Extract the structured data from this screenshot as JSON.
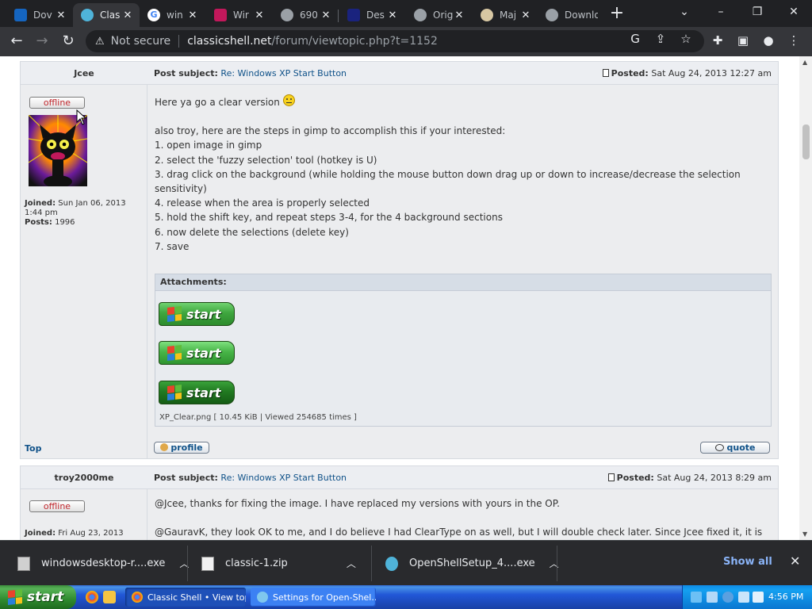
{
  "colors": {
    "chrome_bg": "#202124",
    "toolbar_bg": "#35363a",
    "link": "#105289",
    "offline": "#c0272d",
    "xp_start_green": "#2f8b2f",
    "xp_taskbar_blue": "#2157d7"
  },
  "tabs": [
    {
      "label": "Dov",
      "icon": "site-s-icon",
      "color": "#1565c0"
    },
    {
      "label": "Clas",
      "icon": "classic-shell-icon",
      "color": "#4fb3d9",
      "active": true
    },
    {
      "label": "win",
      "icon": "google-icon",
      "color": "#ffffff"
    },
    {
      "label": "Wir",
      "icon": "image-icon",
      "color": "#c2185b"
    },
    {
      "label": "690",
      "icon": "globe-icon",
      "color": "#9aa0a6"
    },
    {
      "label": "Des",
      "icon": "deviantart-icon",
      "color": "#1a237e"
    },
    {
      "label": "Orig",
      "icon": "globe-icon",
      "color": "#9aa0a6"
    },
    {
      "label": "Maj",
      "icon": "avatar-icon",
      "color": "#d7c7a3"
    },
    {
      "label": "Downlo",
      "icon": "globe-icon",
      "color": "#9aa0a6"
    }
  ],
  "omnibox": {
    "security": "Not secure",
    "host": "classicshell.net",
    "path": "/forum/viewtopic.php?t=1152"
  },
  "posts": [
    {
      "author": "Jcee",
      "subject_label": "Post subject:",
      "subject": "Re: Windows XP Start Button",
      "posted_label": "Posted:",
      "posted": "Sat Aug 24, 2013 12:27 am",
      "status": "offline",
      "joined_label": "Joined:",
      "joined": "Sun Jan 06, 2013 1:44 pm",
      "posts_label": "Posts:",
      "posts_count": "1996",
      "greeting": "Here ya go a clear version",
      "lines": [
        "also troy, here are the steps in gimp to accomplish this if your interested:",
        "1. open image in gimp",
        "2. select the 'fuzzy selection' tool (hotkey is U)",
        "3. drag click on the background (while holding the mouse button down drag up or down to increase/decrease the selection",
        "sensitivity)",
        "4. release when the area is properly selected",
        "5. hold the shift key, and repeat steps 3-4, for the 4 background sections",
        "6. now delete the selections (delete key)",
        "7. save"
      ],
      "attachments_label": "Attachments:",
      "start_label": "start",
      "attachment_caption": "XP_Clear.png [ 10.45 KiB | Viewed 254685 times ]",
      "top_link": "Top",
      "profile_label": "profile",
      "quote_label": "quote"
    },
    {
      "author": "troy2000me",
      "subject_label": "Post subject:",
      "subject": "Re: Windows XP Start Button",
      "posted_label": "Posted:",
      "posted": "Sat Aug 24, 2013 8:29 am",
      "status": "offline",
      "joined_label": "Joined:",
      "joined": "Fri Aug 23, 2013",
      "line1": "@Jcee, thanks for fixing the image. I have replaced my versions with yours in the OP.",
      "line2": "@GauravK, they look OK to me, and I do believe I had ClearType on as well, but I will double check later. Since Jcee fixed it, it is"
    }
  ],
  "downloads": {
    "items": [
      {
        "name": "windowsdesktop-r....exe"
      },
      {
        "name": "classic-1.zip"
      },
      {
        "name": "OpenShellSetup_4....exe"
      }
    ],
    "show_all": "Show all"
  },
  "taskbar": {
    "start_label": "start",
    "tasks": [
      {
        "label": "Classic Shell • View top...",
        "active": true
      },
      {
        "label": "Settings for Open-Shel...",
        "active": false
      }
    ],
    "clock": "4:56 PM"
  }
}
